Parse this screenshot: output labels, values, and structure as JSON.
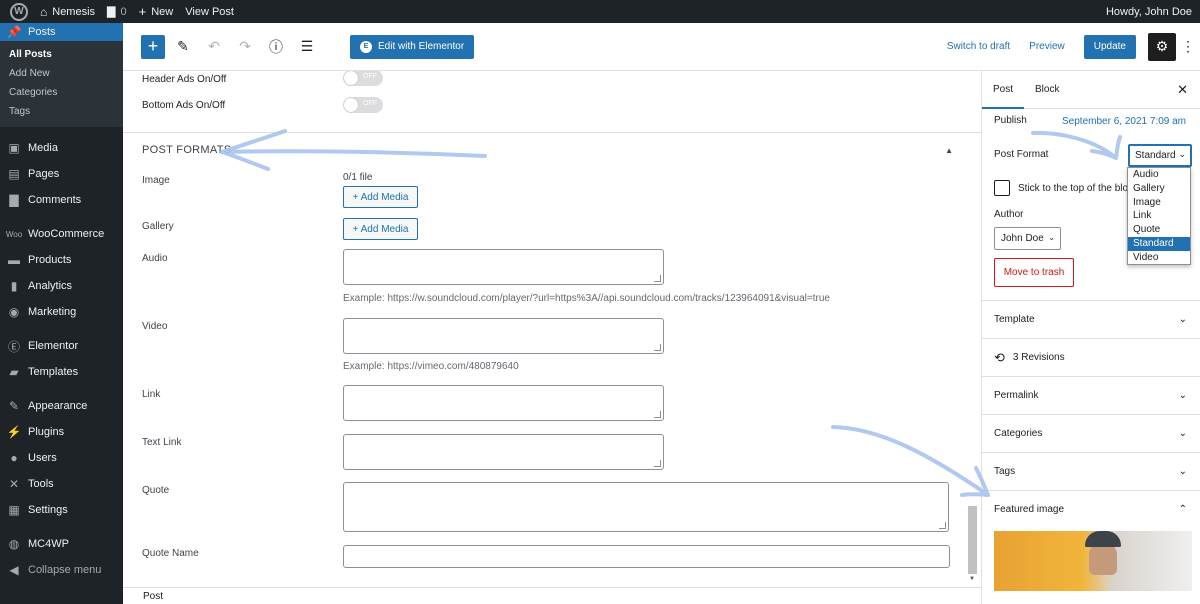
{
  "adminbar": {
    "site_name": "Nemesis",
    "comments_count": "0",
    "new_label": "New",
    "view_post_label": "View Post",
    "howdy": "Howdy, John Doe"
  },
  "menu": {
    "items": [
      {
        "label": "Posts",
        "icon": "pushpin-icon"
      },
      {
        "label": "Media",
        "icon": "media-icon"
      },
      {
        "label": "Pages",
        "icon": "pages-icon"
      },
      {
        "label": "Comments",
        "icon": "comments-icon"
      },
      {
        "label": "WooCommerce",
        "icon": "woocommerce-icon"
      },
      {
        "label": "Products",
        "icon": "products-icon"
      },
      {
        "label": "Analytics",
        "icon": "analytics-icon"
      },
      {
        "label": "Marketing",
        "icon": "megaphone-icon"
      },
      {
        "label": "Elementor",
        "icon": "elementor-icon"
      },
      {
        "label": "Templates",
        "icon": "folder-icon"
      },
      {
        "label": "Appearance",
        "icon": "paintbrush-icon"
      },
      {
        "label": "Plugins",
        "icon": "plugin-icon"
      },
      {
        "label": "Users",
        "icon": "users-icon"
      },
      {
        "label": "Tools",
        "icon": "wrench-icon"
      },
      {
        "label": "Settings",
        "icon": "settings-icon"
      },
      {
        "label": "MC4WP",
        "icon": "mc4wp-icon"
      },
      {
        "label": "Collapse menu",
        "icon": "collapse-icon"
      }
    ],
    "posts_submenu": [
      "All Posts",
      "Add New",
      "Categories",
      "Tags"
    ]
  },
  "header": {
    "elementor_label": "Edit with Elementor",
    "switch_draft": "Switch to draft",
    "preview": "Preview",
    "update": "Update"
  },
  "content": {
    "header_ads_label": "Header Ads On/Off",
    "bottom_ads_label": "Bottom Ads On/Off",
    "toggle_off": "OFF",
    "section_title": "POST FORMATS",
    "image_label": "Image",
    "file_count": "0/1 file",
    "add_media": "+ Add Media",
    "gallery_label": "Gallery",
    "audio_label": "Audio",
    "audio_hint": "Example: https://w.soundcloud.com/player/?url=https%3A//api.soundcloud.com/tracks/123964091&visual=true",
    "video_label": "Video",
    "video_hint": "Example: https://vimeo.com/480879640",
    "link_label": "Link",
    "text_link_label": "Text Link",
    "quote_label": "Quote",
    "quote_name_label": "Quote Name"
  },
  "footer": {
    "breadcrumb": "Post"
  },
  "sidebar": {
    "tab_post": "Post",
    "tab_block": "Block",
    "publish_label": "Publish",
    "publish_date": "September 6, 2021 7:09 am",
    "post_format_label": "Post Format",
    "post_format_value": "Standard",
    "sticky_label": "Stick to the top of the blog",
    "author_label": "Author",
    "author_value": "John Doe",
    "trash": "Move to trash",
    "panels": {
      "template": "Template",
      "revisions": "3 Revisions",
      "permalink": "Permalink",
      "categories": "Categories",
      "tags": "Tags",
      "featured": "Featured image"
    }
  },
  "dropdown": {
    "options": [
      "Audio",
      "Gallery",
      "Image",
      "Link",
      "Quote",
      "Standard",
      "Video"
    ],
    "selected": "Standard"
  },
  "colors": {
    "accent": "#2271b1",
    "admin_bg": "#1d2327",
    "danger": "#cc1818",
    "annotation": "#a9c2ee"
  }
}
